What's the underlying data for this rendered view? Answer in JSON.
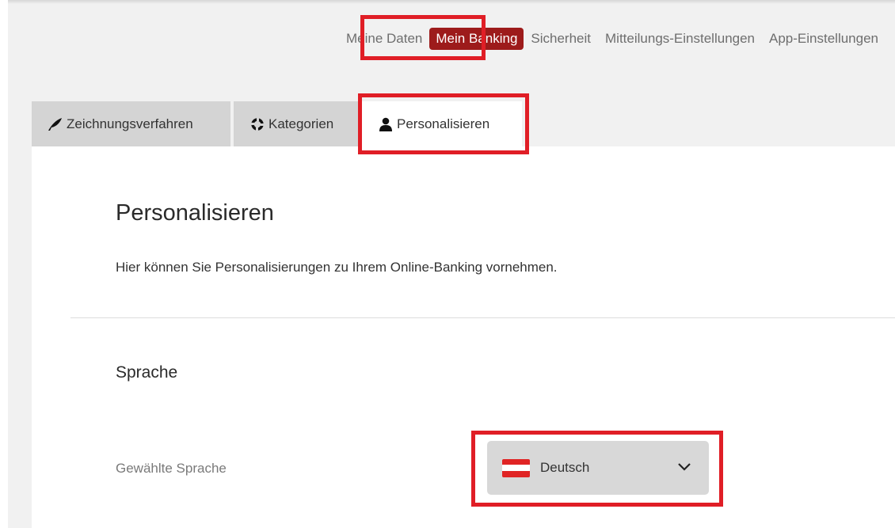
{
  "topnav": {
    "items": [
      {
        "label": "Meine Daten"
      },
      {
        "label": "Mein Banking"
      },
      {
        "label": "Sicherheit"
      },
      {
        "label": "Mitteilungs-Einstellungen"
      },
      {
        "label": "App-Einstellungen"
      }
    ],
    "active_index": 1
  },
  "tabs": [
    {
      "label": "Zeichnungsverfahren",
      "icon": "feather-icon"
    },
    {
      "label": "Kategorien",
      "icon": "cycle-icon"
    },
    {
      "label": "Personalisieren",
      "icon": "user-icon",
      "active": true
    }
  ],
  "main": {
    "title": "Personalisieren",
    "description": "Hier können Sie Personalisierungen zu Ihrem Online-Banking vornehmen.",
    "section_title": "Sprache",
    "language_label": "Gewählte Sprache",
    "language_value": "Deutsch",
    "language_flag": "austria-flag-icon"
  },
  "colors": {
    "accent": "#9d1b1b",
    "highlight_box": "#e01e26",
    "flag_red": "#e02424"
  }
}
